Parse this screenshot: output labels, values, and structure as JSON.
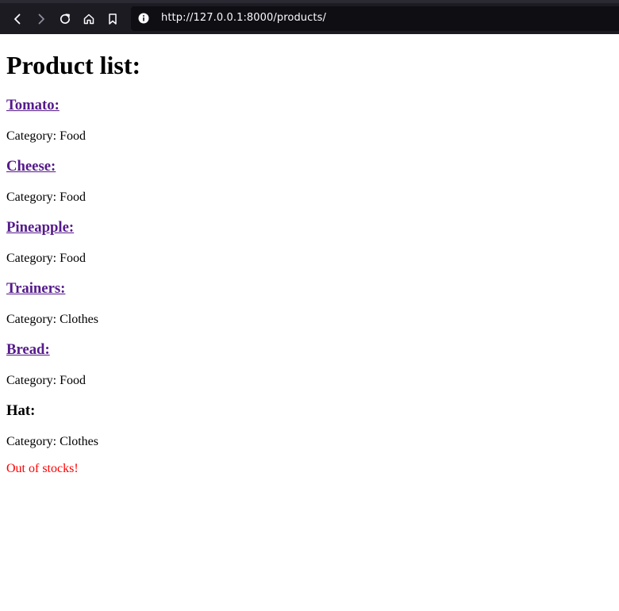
{
  "browser": {
    "url": "http://127.0.0.1:8000/products/",
    "back_icon": "chevron-left-icon",
    "forward_icon": "chevron-right-icon",
    "reload_icon": "reload-icon",
    "home_icon": "home-icon",
    "bookmark_icon": "bookmark-icon",
    "info_icon": "info-icon"
  },
  "page": {
    "title": "Product list:",
    "products": [
      {
        "name": "Tomato:",
        "category": "Category: Food",
        "linked": true
      },
      {
        "name": "Cheese:",
        "category": "Category: Food",
        "linked": true
      },
      {
        "name": "Pineapple:",
        "category": "Category: Food",
        "linked": true
      },
      {
        "name": "Trainers:",
        "category": "Category: Clothes",
        "linked": true
      },
      {
        "name": "Bread:",
        "category": "Category: Food",
        "linked": true
      },
      {
        "name": "Hat:",
        "category": "Category: Clothes",
        "linked": false,
        "note": "Out of stocks!"
      }
    ]
  },
  "colors": {
    "link": "#551a8b",
    "warning": "#ff0000",
    "toolbar_bg": "#1c1b22",
    "urlbar_bg": "#0f0e13"
  }
}
